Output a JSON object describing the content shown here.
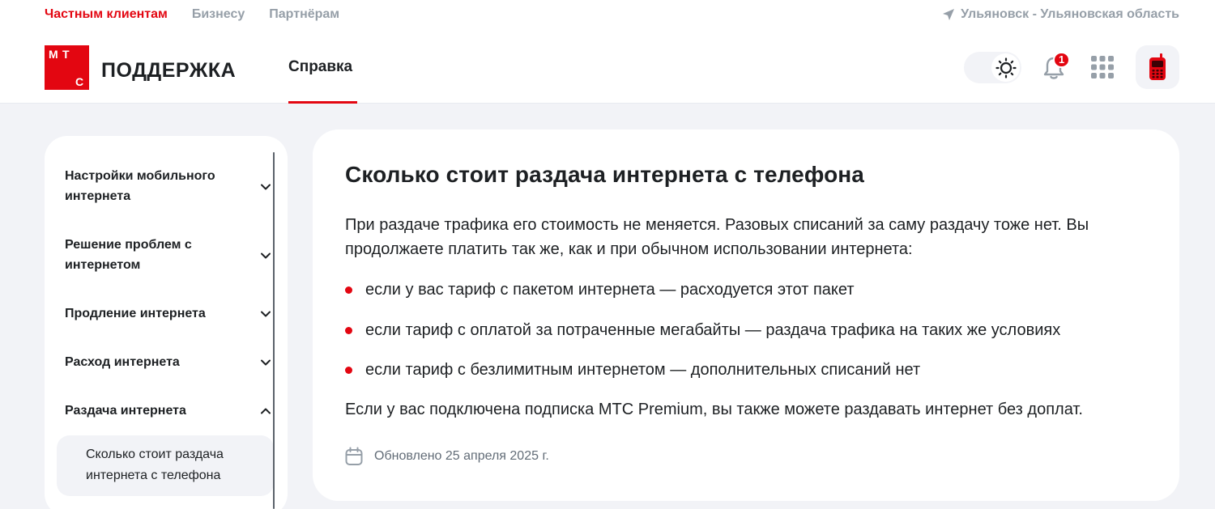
{
  "header": {
    "segments": [
      "Частным клиентам",
      "Бизнесу",
      "Партнёрам"
    ],
    "active_segment": "Частным клиентам",
    "region": "Ульяновск - Ульяновская область",
    "logo_letters": [
      "М",
      "Т",
      "С"
    ],
    "logo_title": "ПОДДЕРЖКА",
    "main_tab": "Справка",
    "notification_count": "1",
    "icons": [
      "location-arrow-icon",
      "sun-icon",
      "bell-icon",
      "apps-grid-icon",
      "mobile-phone-icon"
    ],
    "accent_color": "#e30611"
  },
  "sidebar": {
    "items": [
      {
        "label": "Настройки мобильного интернета",
        "expanded": false
      },
      {
        "label": "Решение проблем с интернетом",
        "expanded": false
      },
      {
        "label": "Продление интернета",
        "expanded": false
      },
      {
        "label": "Расход интернета",
        "expanded": false
      },
      {
        "label": "Раздача интернета",
        "expanded": true
      }
    ],
    "active_subitem": "Сколько стоит раздача интернета с телефона"
  },
  "article": {
    "title": "Сколько стоит раздача интернета с телефона",
    "intro": "При раздаче трафика его стоимость не меняется. Разовых списаний за саму раздачу тоже нет. Вы продолжаете платить так же, как и при обычном использовании интернета:",
    "bullets": [
      "если у вас тариф с пакетом интернета — расходуется этот пакет",
      "если тариф с оплатой за потраченные мегабайты — раздача трафика на таких же условиях",
      "если тариф с безлимитным интернетом — дополнительных списаний нет"
    ],
    "note": "Если у вас подключена подписка МТС Premium, вы также можете раздавать интернет без доплат.",
    "updated": "Обновлено 25 апреля 2025 г."
  }
}
